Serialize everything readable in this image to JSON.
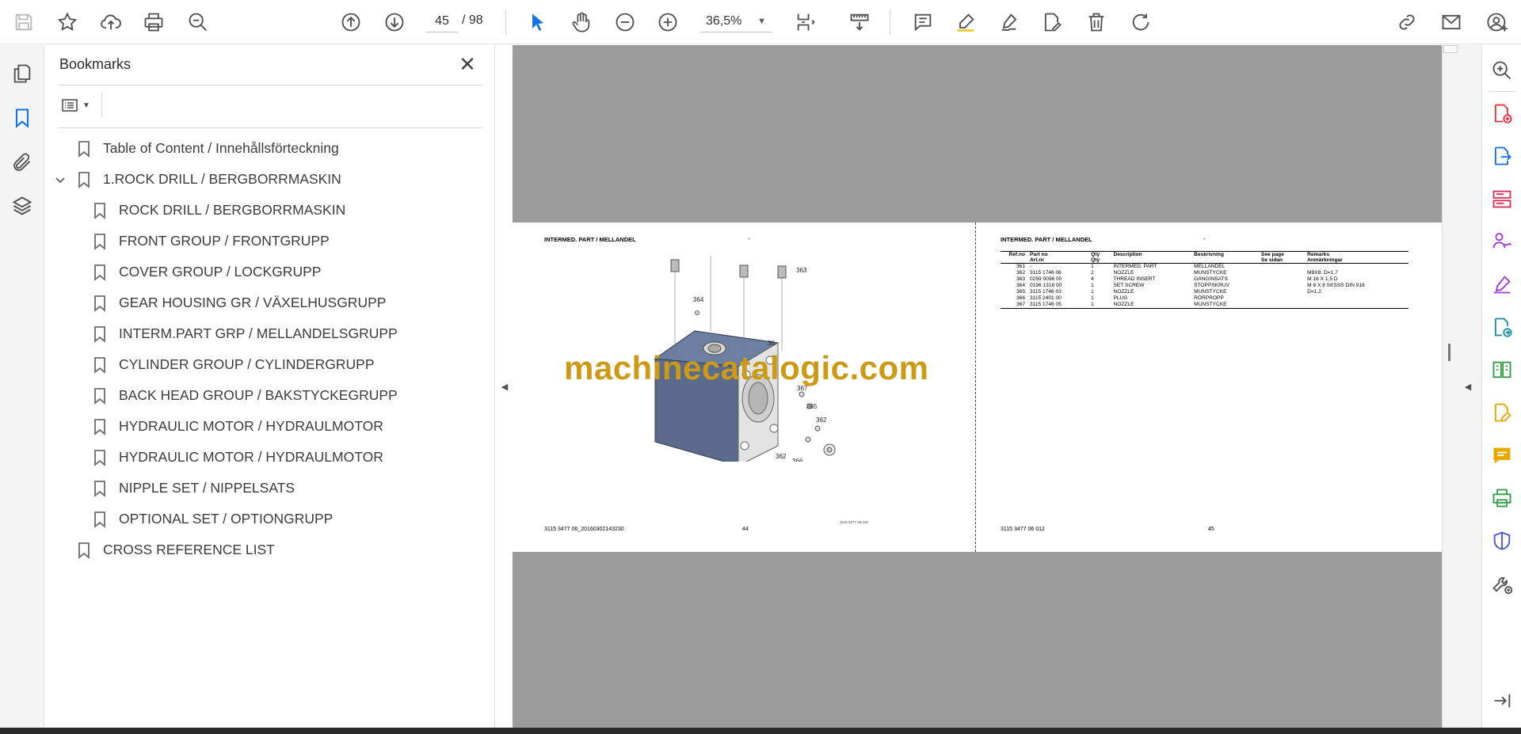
{
  "toolbar": {
    "icons": [
      "save-icon",
      "star-icon",
      "upload-icon",
      "print-icon",
      "search-icon",
      "arrow-up-circle-icon",
      "arrow-down-circle-icon",
      "zoom-out-icon",
      "zoom-in-icon",
      "select-cursor-icon",
      "hand-icon",
      "page-fit-icon",
      "scroll-mode-icon",
      "comment-icon",
      "highlight-icon",
      "draw-icon",
      "edit-text-icon",
      "delete-icon",
      "rotate-icon",
      "share-link-icon",
      "email-icon",
      "account-icon"
    ],
    "current_page": "45",
    "total_pages": "/ 98",
    "zoom_level": "36,5%"
  },
  "left_rail": {
    "icons": [
      "pages-icon",
      "bookmark-icon",
      "attachment-icon",
      "layers-icon"
    ],
    "active": "bookmark-icon"
  },
  "bookmarks_panel": {
    "title": "Bookmarks",
    "items": [
      {
        "label": "Table of Content / Innehållsförteckning",
        "level": 0,
        "expanded": null
      },
      {
        "label": "1.ROCK DRILL / BERGBORRMASKIN",
        "level": 0,
        "expanded": true
      },
      {
        "label": "ROCK DRILL / BERGBORRMASKIN",
        "level": 1,
        "expanded": null
      },
      {
        "label": "FRONT GROUP / FRONTGRUPP",
        "level": 1,
        "expanded": null
      },
      {
        "label": "COVER GROUP / LOCKGRUPP",
        "level": 1,
        "expanded": null
      },
      {
        "label": "GEAR HOUSING GR / VÄXELHUSGRUPP",
        "level": 1,
        "expanded": null
      },
      {
        "label": "INTERM.PART GRP / MELLANDELSGRUPP",
        "level": 1,
        "expanded": null
      },
      {
        "label": "CYLINDER GROUP / CYLINDERGRUPP",
        "level": 1,
        "expanded": null
      },
      {
        "label": "BACK HEAD GROUP / BAKSTYCKEGRUPP",
        "level": 1,
        "expanded": null
      },
      {
        "label": "HYDRAULIC MOTOR / HYDRAULMOTOR",
        "level": 1,
        "expanded": null
      },
      {
        "label": "HYDRAULIC MOTOR / HYDRAULMOTOR",
        "level": 1,
        "expanded": null
      },
      {
        "label": "NIPPLE SET / NIPPELSATS",
        "level": 1,
        "expanded": null
      },
      {
        "label": "OPTIONAL SET / OPTIONGRUPP",
        "level": 1,
        "expanded": null
      },
      {
        "label": "CROSS REFERENCE LIST",
        "level": 0,
        "expanded": null
      }
    ]
  },
  "document": {
    "left_page": {
      "header": "INTERMED. PART / MELLANDEL",
      "header_dash": "-",
      "watermark": "machinecatalogic.com",
      "callouts": [
        "363",
        "364",
        "36",
        "367",
        "365",
        "362",
        "362",
        "366"
      ],
      "drawing_code": "3116 3477 06.010",
      "footer_left": "3115 3477 06_20160302143230",
      "footer_page": "44"
    },
    "right_page": {
      "header": "INTERMED. PART / MELLANDEL",
      "header_dash": "-",
      "table_headers": {
        "ref": "Ref.no",
        "part": "Part no\nArt.nr",
        "qty": "Qty\nQty",
        "desc": "Description",
        "beskr": "Beskrivning",
        "see": "See page\nSe sidan",
        "remarks": "Remarks\nAnmärkningar"
      },
      "rows": [
        {
          "ref": "361",
          "part": "-",
          "qty": "1",
          "desc": "INTERMED. PART",
          "beskr": "MELLANDEL",
          "see": "",
          "remarks": ""
        },
        {
          "ref": "362",
          "part": "3115 1746 06",
          "qty": "2",
          "desc": "NOZZLE",
          "beskr": "MUNSTYCKE",
          "see": "",
          "remarks": "M8X8, D=1,7"
        },
        {
          "ref": "363",
          "part": "0259 0096 00",
          "qty": "4",
          "desc": "THREAD INSERT",
          "beskr": "GÄNGINSATS",
          "see": "",
          "remarks": "M 16 X 1,5 D"
        },
        {
          "ref": "364",
          "part": "0196 1318 00",
          "qty": "1",
          "desc": "SET SCREW",
          "beskr": "STOPPSKRUV",
          "see": "",
          "remarks": "M 8 X 8 SKSSS DIN 916"
        },
        {
          "ref": "365",
          "part": "3115 1746 03",
          "qty": "1",
          "desc": "NOZZLE",
          "beskr": "MUNSTYCKE",
          "see": "",
          "remarks": "D=1,2"
        },
        {
          "ref": "366",
          "part": "3115 2401 00",
          "qty": "1",
          "desc": "PLUG",
          "beskr": "RÖRPROPP",
          "see": "",
          "remarks": ""
        },
        {
          "ref": "367",
          "part": "3115 1746 05",
          "qty": "1",
          "desc": "NOZZLE",
          "beskr": "MUNSTYCKE",
          "see": "",
          "remarks": ""
        }
      ],
      "footer_left": "3115 3477 06 012",
      "footer_page": "45"
    }
  },
  "right_rail": {
    "icons": [
      "zoom-search-icon",
      "create-pdf-icon",
      "export-pdf-icon",
      "organize-pages-icon",
      "request-signature-icon",
      "fill-sign-icon",
      "convert-pdf-icon",
      "compare-files-icon",
      "edit-pdf-icon",
      "comment-tool-icon",
      "scan-ocr-icon",
      "protect-icon",
      "more-tools-icon",
      "collapse-pane-icon"
    ]
  },
  "colors": {
    "accent_blue": "#1473e6",
    "watermark_gold": "#cc9a14",
    "drawing_block": "#5a6b8c",
    "gray_background": "#9c9c9c"
  }
}
